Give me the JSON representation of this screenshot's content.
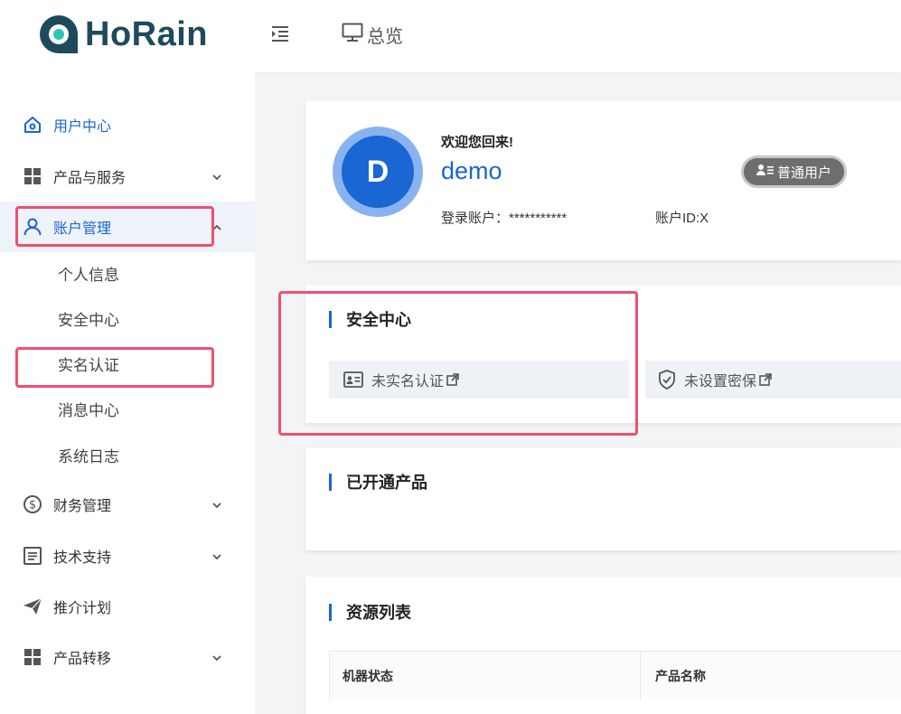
{
  "app": {
    "brand": "HoRain",
    "overview_label": "总览"
  },
  "sidebar": {
    "items": [
      {
        "label": "用户中心",
        "icon": "home-icon"
      },
      {
        "label": "产品与服务",
        "icon": "grid-icon"
      },
      {
        "label": "账户管理",
        "icon": "user-icon"
      },
      {
        "label": "财务管理",
        "icon": "dollar-icon"
      },
      {
        "label": "技术支持",
        "icon": "document-icon"
      },
      {
        "label": "推介计划",
        "icon": "paper-plane-icon"
      },
      {
        "label": "产品转移",
        "icon": "grid-icon"
      }
    ],
    "sub_items": [
      "个人信息",
      "安全中心",
      "实名认证",
      "消息中心",
      "系统日志"
    ]
  },
  "profile": {
    "avatar_letter": "D",
    "welcome": "欢迎您回来!",
    "username": "demo",
    "login_account": "登录账户：***********",
    "account_id": "账户ID:X",
    "badge": "普通用户"
  },
  "security": {
    "title": "安全中心",
    "realname": "未实名认证",
    "protection": "未设置密保"
  },
  "products": {
    "title": "已开通产品"
  },
  "resources": {
    "title": "资源列表",
    "columns": [
      "机器状态",
      "产品名称"
    ]
  },
  "colors": {
    "accent": "#1a66d2",
    "highlight": "#f0506e",
    "brand_dark": "#1d4b5c"
  }
}
